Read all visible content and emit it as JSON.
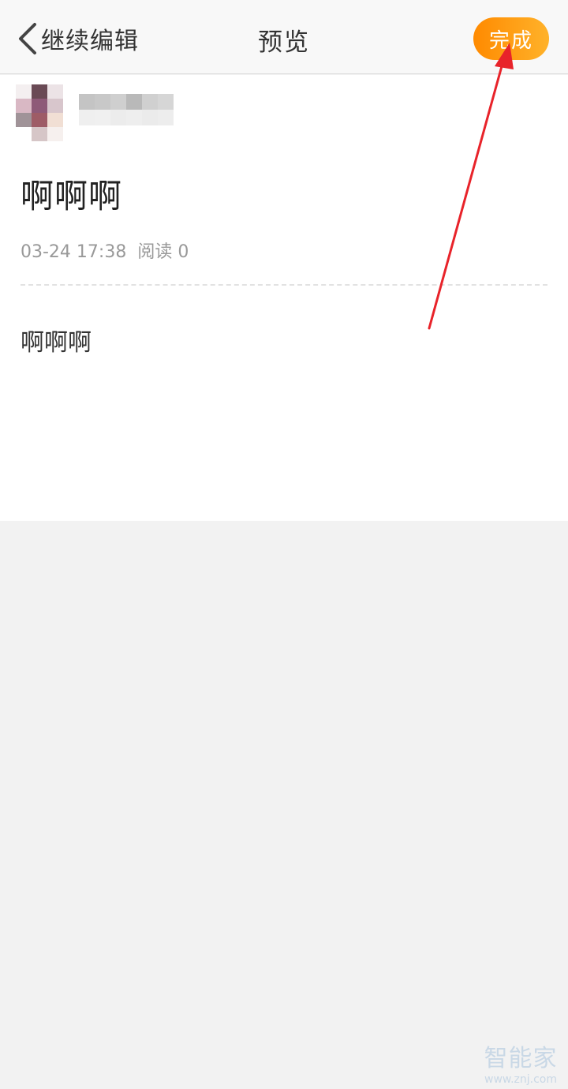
{
  "header": {
    "back_label": "继续编辑",
    "title": "预览",
    "done_label": "完成"
  },
  "article": {
    "title": "啊啊啊",
    "timestamp": "03-24 17:38",
    "read_count": "阅读 0",
    "body": "啊啊啊"
  },
  "watermark": {
    "logo": "智能家",
    "url": "www.znj.com"
  },
  "colors": {
    "accent_start": "#ff8a00",
    "accent_end": "#ffb22a",
    "annotation_arrow": "#e8232a"
  },
  "icons": {
    "back": "chevron-left-icon"
  }
}
